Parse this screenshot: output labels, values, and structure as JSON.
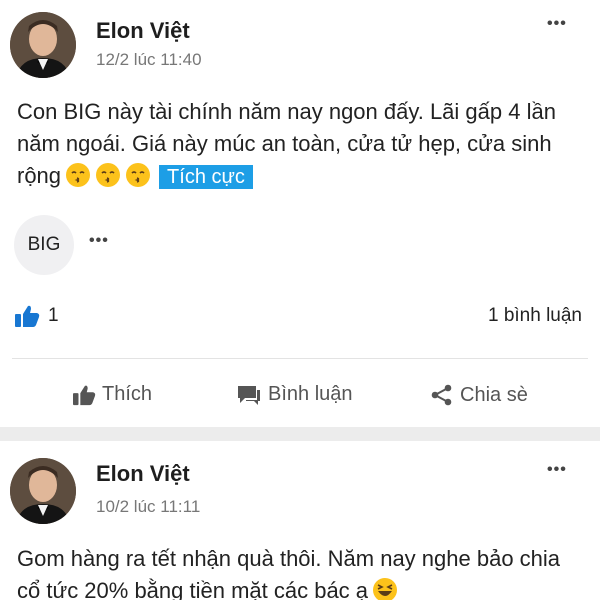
{
  "posts": [
    {
      "author": "Elon Việt",
      "time": "12/2 lúc 11:40",
      "more": "•••",
      "content": "Con BIG này tài chính năm nay ngon đấy. Lãi gấp 4 lần năm ngoái. Giá này múc an toàn, cửa tử hẹp, cửa sinh rộng",
      "emoji_icon": "kissing-face-icon",
      "tag": "Tích cực",
      "ticker": "BIG",
      "ticker_more": "•••",
      "likes": "1",
      "comments": "1 bình luận",
      "actions": {
        "like": "Thích",
        "comment": "Bình luận",
        "share": "Chia sè"
      }
    },
    {
      "author": "Elon Việt",
      "time": "10/2 lúc 11:11",
      "more": "•••",
      "content": "Gom hàng ra tết nhận quà thôi. Năm nay nghe bảo chia cổ tức 20% bằng tiền mặt các bác ạ",
      "emoji_icon": "laughing-face-icon"
    }
  ],
  "colors": {
    "accent": "#1d9ee6",
    "like_icon": "#1877d2",
    "band": "#ececec"
  }
}
